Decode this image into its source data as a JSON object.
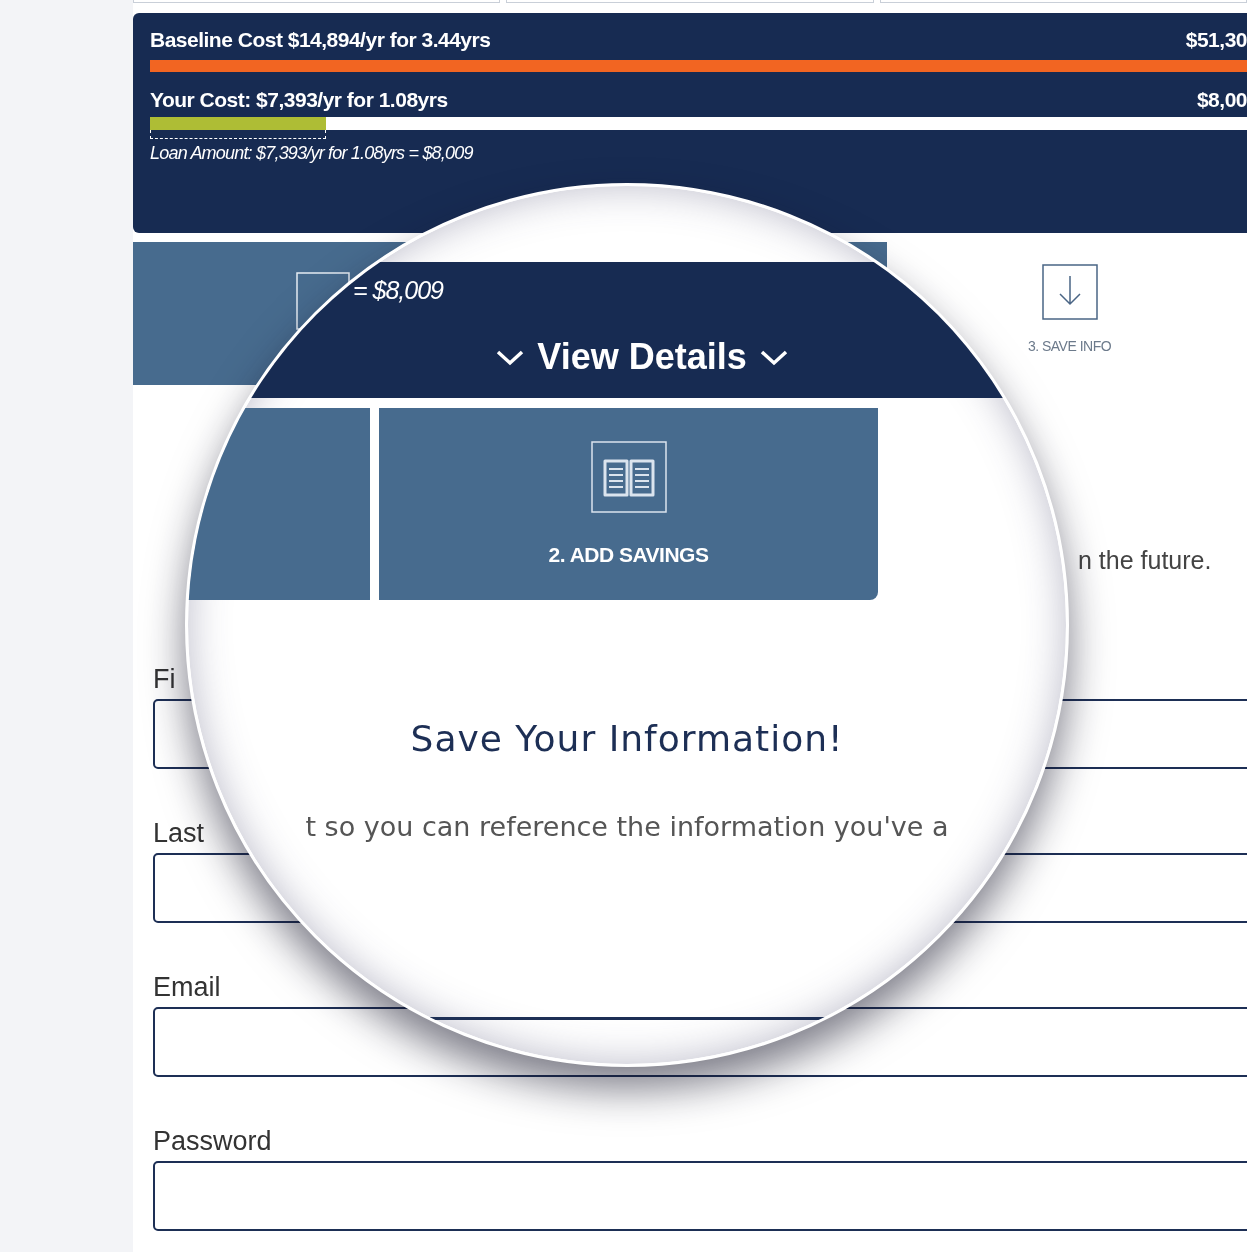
{
  "summary": {
    "baseline": {
      "label": "Baseline Cost $14,894/yr for 3.44yrs",
      "total": "$51,30",
      "level": 1
    },
    "your_cost": {
      "label": "Your Cost: $7,393/yr for 1.08yrs",
      "total": "$8,00",
      "level": 0.16
    },
    "loan_note": "Loan Amount: $7,393/yr for 1.08yrs = $8,009"
  },
  "steps": [
    {
      "selected": false
    },
    {
      "selected": false
    },
    {
      "label": "3. SAVE INFO",
      "selected": true
    }
  ],
  "intro_fragment": "n the future.",
  "form": {
    "fields": [
      {
        "label": "Fi"
      },
      {
        "label": "Last"
      },
      {
        "label": "Email"
      },
      {
        "label": "Password"
      }
    ]
  },
  "magnifier": {
    "total_fragment": "= $8,009",
    "toggle": "View Details",
    "step_label": "2. ADD SAVINGS",
    "heading": "Save Your Information!",
    "text": "t so you can reference the information you've a"
  }
}
